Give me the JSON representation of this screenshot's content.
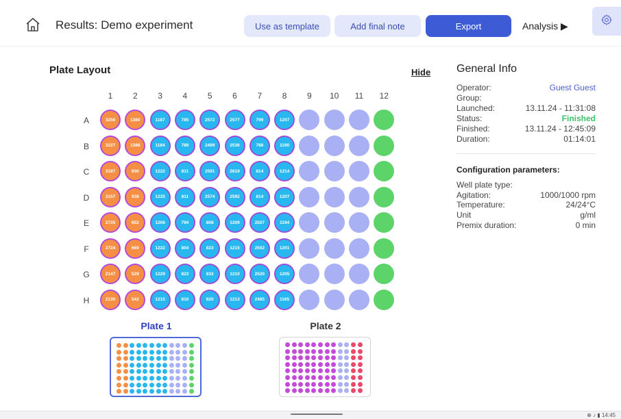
{
  "header": {
    "title": "Results: Demo experiment",
    "use_template_label": "Use as template",
    "add_note_label": "Add final note",
    "export_label": "Export",
    "analysis_label": "Analysis ▶"
  },
  "plate": {
    "title": "Plate Layout",
    "hide_label": "Hide",
    "columns": [
      "1",
      "2",
      "3",
      "4",
      "5",
      "6",
      "7",
      "8",
      "9",
      "10",
      "11",
      "12"
    ],
    "rows": [
      {
        "label": "A",
        "values": [
          "3256",
          "1380",
          "1187",
          "785",
          "2572",
          "2577",
          "799",
          "1207"
        ]
      },
      {
        "label": "B",
        "values": [
          "3227",
          "1388",
          "1184",
          "789",
          "2499",
          "2536",
          "788",
          "1190"
        ]
      },
      {
        "label": "C",
        "values": [
          "3187",
          "930",
          "1222",
          "811",
          "2591",
          "2619",
          "814",
          "1214"
        ]
      },
      {
        "label": "D",
        "values": [
          "3157",
          "938",
          "1225",
          "811",
          "2574",
          "2592",
          "814",
          "1207"
        ]
      },
      {
        "label": "E",
        "values": [
          "2735",
          "652",
          "1206",
          "794",
          "808",
          "1209",
          "2507",
          "1194"
        ]
      },
      {
        "label": "F",
        "values": [
          "2724",
          "669",
          "1222",
          "804",
          "823",
          "1215",
          "2502",
          "1201"
        ]
      },
      {
        "label": "G",
        "values": [
          "2147",
          "529",
          "1229",
          "823",
          "833",
          "1210",
          "2520",
          "1205"
        ]
      },
      {
        "label": "H",
        "values": [
          "2130",
          "542",
          "1215",
          "810",
          "820",
          "1213",
          "2485",
          "1165"
        ]
      }
    ],
    "plates": [
      {
        "label": "Plate 1",
        "column_colors": [
          "#f58f46",
          "#f58f46",
          "#29b7f0",
          "#29b7f0",
          "#29b7f0",
          "#29b7f0",
          "#29b7f0",
          "#29b7f0",
          "#aab0f4",
          "#aab0f4",
          "#aab0f4",
          "#5cd46a"
        ]
      },
      {
        "label": "Plate 2",
        "column_colors": [
          "#c44ad8",
          "#c44ad8",
          "#c44ad8",
          "#c44ad8",
          "#c44ad8",
          "#c44ad8",
          "#c44ad8",
          "#c44ad8",
          "#aab0f4",
          "#aab0f4",
          "#e84a6a",
          "#e84a6a"
        ]
      }
    ]
  },
  "info": {
    "title": "General Info",
    "rows": [
      {
        "label": "Operator:",
        "value": "Guest Guest",
        "style": "link"
      },
      {
        "label": "Group:",
        "value": "",
        "style": ""
      },
      {
        "label": "Launched:",
        "value": "13.11.24 - 11:31:08",
        "style": ""
      },
      {
        "label": "Status:",
        "value": "Finished",
        "style": "ok"
      },
      {
        "label": "Finished:",
        "value": "13.11.24 - 12:45:09",
        "style": ""
      },
      {
        "label": "Duration:",
        "value": "01:14:01",
        "style": ""
      }
    ],
    "config_title": "Configuration parameters:",
    "config_rows": [
      {
        "label": "Well plate type:",
        "value": ""
      },
      {
        "label": "Agitation:",
        "value": "1000/1000 rpm"
      },
      {
        "label": "Temperature:",
        "value": "24/24°C"
      },
      {
        "label": "Unit",
        "value": "g/ml"
      },
      {
        "label": "Premix duration:",
        "value": "0 min"
      }
    ]
  },
  "taskbar": {
    "clock": "14:45"
  }
}
